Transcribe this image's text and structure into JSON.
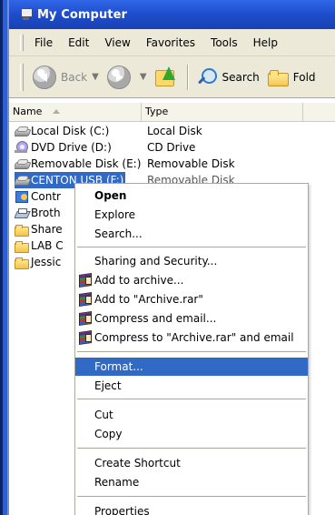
{
  "window": {
    "title": "My Computer"
  },
  "menu_bar": {
    "items": [
      "File",
      "Edit",
      "View",
      "Favorites",
      "Tools",
      "Help"
    ]
  },
  "toolbar": {
    "back_label": "Back",
    "search_label": "Search",
    "folders_label": "Fold"
  },
  "file_list": {
    "columns": [
      "Name",
      "Type"
    ],
    "rows": [
      {
        "name": "Local Disk (C:)",
        "type": "Local Disk",
        "icon": "local-disk-icon"
      },
      {
        "name": "DVD Drive (D:)",
        "type": "CD Drive",
        "icon": "dvd-drive-icon"
      },
      {
        "name": "Removable Disk (E:)",
        "type": "Removable Disk",
        "icon": "removable-disk-icon"
      },
      {
        "name": "CENTON USB (F:)",
        "type": "Removable Disk",
        "icon": "usb-drive-icon",
        "selected": true
      },
      {
        "name": "Contr",
        "type": "",
        "icon": "control-panel-icon"
      },
      {
        "name": "Broth",
        "type": "",
        "icon": "printer-icon"
      },
      {
        "name": "Share",
        "type": "",
        "icon": "folder-icon"
      },
      {
        "name": "LAB C",
        "type": "",
        "icon": "folder-icon"
      },
      {
        "name": "Jessic",
        "type": "",
        "icon": "folder-icon"
      }
    ]
  },
  "context_menu": {
    "items": {
      "open": "Open",
      "explore": "Explore",
      "search": "Search...",
      "sharing": "Sharing and Security...",
      "add_archive": "Add to archive...",
      "add_archive_rar": "Add to \"Archive.rar\"",
      "compress_email": "Compress and email...",
      "compress_rar_email": "Compress to \"Archive.rar\" and email",
      "format": "Format...",
      "eject": "Eject",
      "cut": "Cut",
      "copy": "Copy",
      "create_shortcut": "Create Shortcut",
      "rename": "Rename",
      "properties": "Properties"
    }
  },
  "colors": {
    "title_bar": "#1f4dcb",
    "selection": "#316ac5",
    "menu_background": "#ece9d8"
  }
}
